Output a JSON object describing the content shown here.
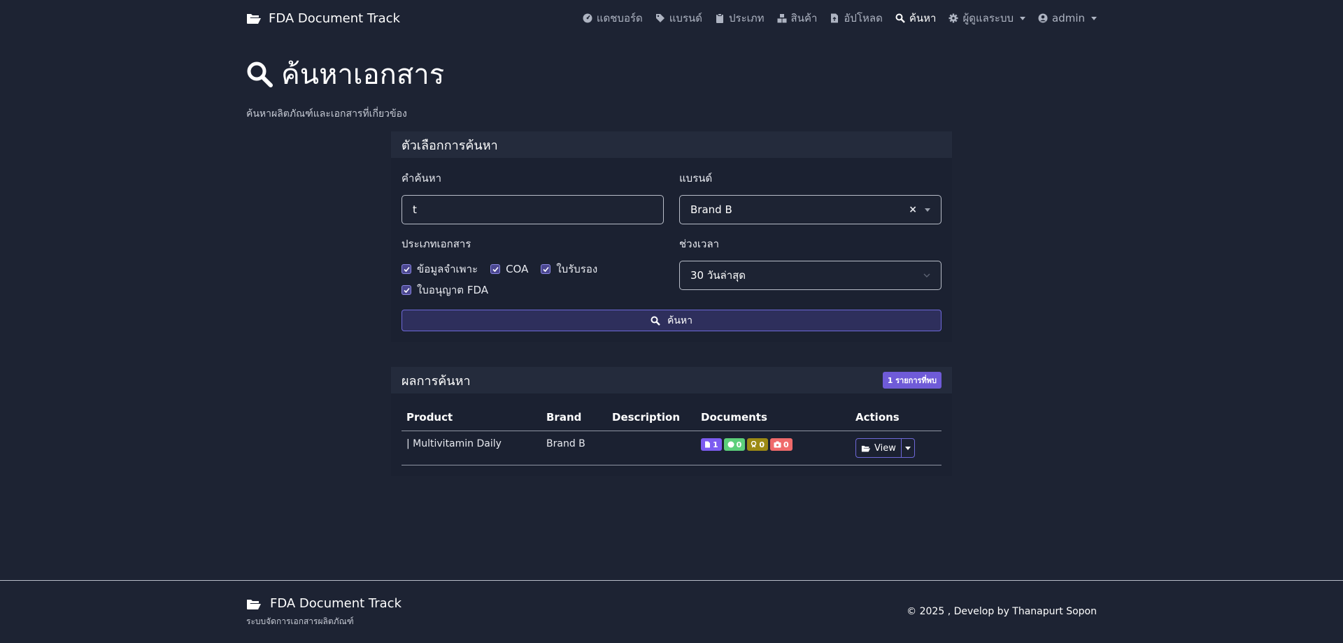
{
  "navbar": {
    "brand": "FDA Document Track",
    "items": [
      {
        "label": "แดชบอร์ด",
        "icon": "dashboard-icon"
      },
      {
        "label": "แบรนด์",
        "icon": "tags-icon"
      },
      {
        "label": "ประเภท",
        "icon": "clipboard-icon"
      },
      {
        "label": "สินค้า",
        "icon": "boxes-icon"
      },
      {
        "label": "อัปโหลด",
        "icon": "file-upload-icon"
      },
      {
        "label": "ค้นหา",
        "icon": "search-icon",
        "active": true
      },
      {
        "label": "ผู้ดูแลระบบ",
        "icon": "gear-icon",
        "dropdown": true
      },
      {
        "label": "admin",
        "icon": "user-circle-icon",
        "dropdown": true
      }
    ]
  },
  "page": {
    "title": "ค้นหาเอกสาร",
    "subtitle": "ค้นหาผลิตภัณฑ์และเอกสารที่เกี่ยวข้อง"
  },
  "search": {
    "header": "ตัวเลือกการค้นหา",
    "keyword_label": "คำค้นหา",
    "keyword_value": "t",
    "brand_label": "แบรนด์",
    "brand_value": "Brand B",
    "doctype_label": "ประเภทเอกสาร",
    "doctypes": [
      {
        "label": "ข้อมูลจำเพาะ",
        "checked": true
      },
      {
        "label": "COA",
        "checked": true
      },
      {
        "label": "ใบรับรอง",
        "checked": true
      },
      {
        "label": "ใบอนุญาต FDA",
        "checked": true
      }
    ],
    "period_label": "ช่วงเวลา",
    "period_value": "30 วันล่าสุด",
    "button_label": "ค้นหา"
  },
  "results": {
    "header": "ผลการค้นหา",
    "count_badge": "1 รายการที่พบ",
    "columns": [
      "Product",
      "Brand",
      "Description",
      "Documents",
      "Actions"
    ],
    "rows": [
      {
        "product": "| Multivitamin Daily",
        "brand": "Brand B",
        "description": "",
        "documents": [
          {
            "count": "1",
            "icon": "file-icon",
            "color": "#7c5cf0"
          },
          {
            "count": "0",
            "icon": "circle-icon",
            "color": "#5ccf7a"
          },
          {
            "count": "0",
            "icon": "award-icon",
            "color": "#9c8a14"
          },
          {
            "count": "0",
            "icon": "id-card-icon",
            "color": "#ef6a6a"
          }
        ],
        "action_label": "View"
      }
    ]
  },
  "footer": {
    "brand": "FDA Document Track",
    "subtitle": "ระบบจัดการเอกสารผลิตภัณฑ์",
    "copyright": "© 2025 , Develop by Thanapurt Sopon"
  }
}
